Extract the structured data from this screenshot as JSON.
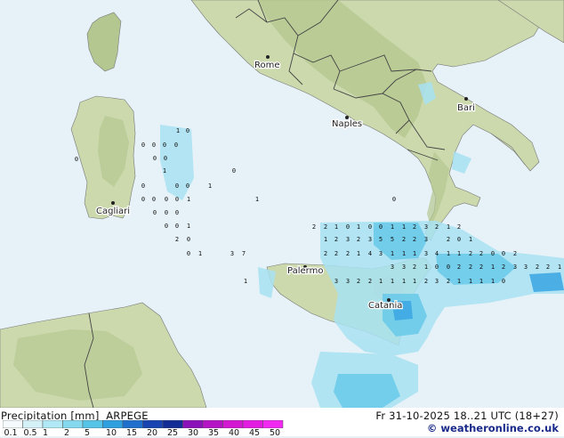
{
  "legend": {
    "title": "Precipitation [mm]",
    "model": "ARPEGE",
    "valid": "Fr 31-10-2025 18..21 UTC (18+27)",
    "credit": "© weatheronline.co.uk",
    "ticks": [
      "0.1",
      "0.5",
      "1",
      "2",
      "5",
      "10",
      "15",
      "20",
      "25",
      "30",
      "35",
      "40",
      "45",
      "50"
    ],
    "colors": [
      "#f5fbfd",
      "#d5f1f8",
      "#b0e8f5",
      "#84d9ee",
      "#55c4e6",
      "#2f9fe0",
      "#1f70cc",
      "#1843b0",
      "#142c96",
      "#8b12b8",
      "#b414c4",
      "#d218d0",
      "#e21ce0",
      "#f02af0"
    ]
  },
  "cities": [
    "Rome",
    "Naples",
    "Bari",
    "Cagliari",
    "Palermo",
    "Catania"
  ],
  "colors": {
    "sea": "#e6f2f8",
    "land": "#cbd9ad",
    "land_high": "#b5c790",
    "border": "#444444",
    "coast": "#666666"
  },
  "precip_values": [
    "1",
    "0",
    "0",
    "0",
    "0",
    "0",
    "0",
    "0",
    "0",
    "1",
    "0",
    "0",
    "0",
    "0",
    "1",
    "0",
    "0",
    "0",
    "0",
    "1",
    "1",
    "0",
    "0",
    "0",
    "0",
    "0",
    "0",
    "1",
    "2",
    "2",
    "1",
    "0",
    "1",
    "0",
    "0",
    "1",
    "1",
    "2",
    "3",
    "2",
    "1",
    "2",
    "2",
    "0",
    "1",
    "2",
    "3",
    "2",
    "3",
    "5",
    "5",
    "2",
    "2",
    "3",
    "2",
    "0",
    "1",
    "0",
    "1",
    "3",
    "7",
    "2",
    "2",
    "2",
    "1",
    "4",
    "3",
    "1",
    "1",
    "1",
    "3",
    "4",
    "1",
    "1",
    "2",
    "2",
    "0",
    "0",
    "2",
    "3",
    "3",
    "2",
    "1",
    "0",
    "0",
    "2",
    "2",
    "2",
    "1",
    "2",
    "3",
    "3",
    "2",
    "2",
    "1",
    "1",
    "3",
    "3",
    "2",
    "2",
    "1",
    "1",
    "1",
    "1",
    "2",
    "3",
    "2",
    "1",
    "1",
    "1",
    "1",
    "0",
    "0"
  ]
}
